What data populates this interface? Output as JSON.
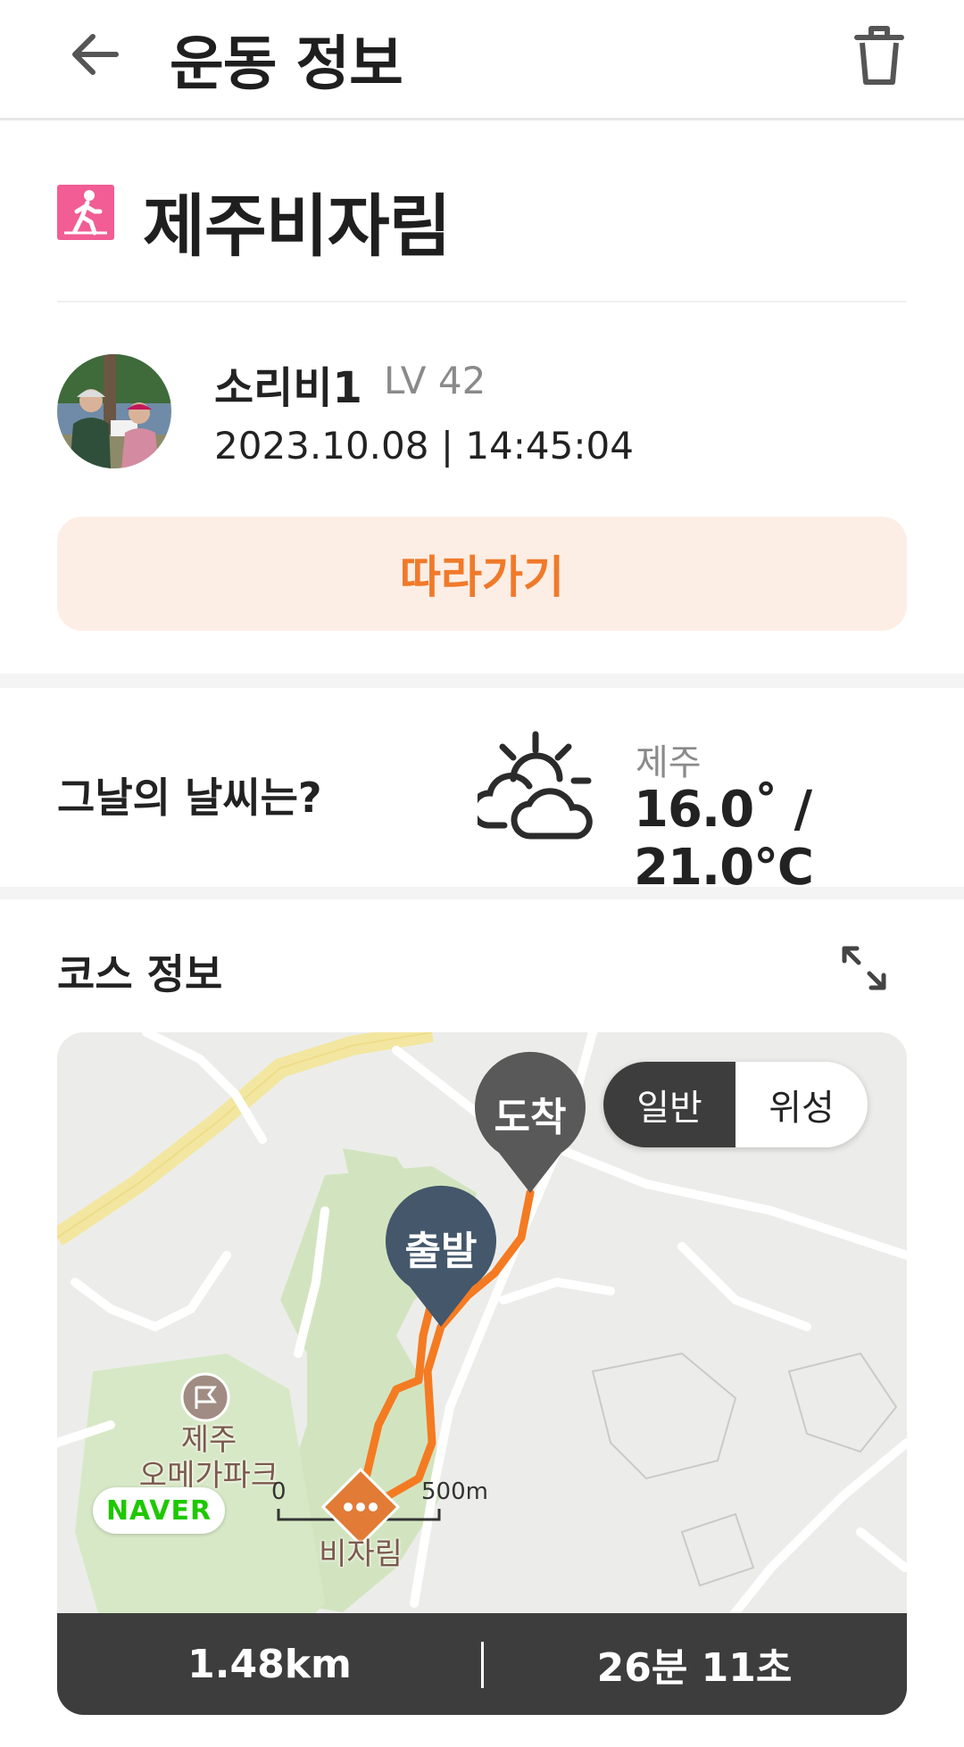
{
  "header": {
    "title": "운동 정보",
    "back_icon": "arrow-left-icon",
    "delete_icon": "trash-icon"
  },
  "course": {
    "name": "제주비자림",
    "activity_icon": "walking-person-icon",
    "activity_icon_color": "#f15d94"
  },
  "user": {
    "name": "소리비1",
    "level": "LV 42",
    "datetime": "2023.10.08 | 14:45:04"
  },
  "follow_button": {
    "label": "따라가기",
    "text_color": "#f07a2a",
    "bg_color": "#fdeee5"
  },
  "weather": {
    "question": "그날의 날씨는?",
    "icon": "partly-cloudy-icon",
    "region": "제주",
    "temperature": "16.0˚ / 21.0℃"
  },
  "course_info": {
    "title": "코스 정보",
    "expand_icon": "expand-icon",
    "map": {
      "toggle": [
        "일반",
        "위성"
      ],
      "selected_toggle": "일반",
      "start_label": "출발",
      "end_label": "도착",
      "park_label": "제주\n오메가파크",
      "place_label": "비자림",
      "provider": "NAVER",
      "scale_start": "0",
      "scale_end": "500m",
      "route_color": "#f47b22"
    },
    "distance": "1.48km",
    "duration": "26분 11초"
  }
}
